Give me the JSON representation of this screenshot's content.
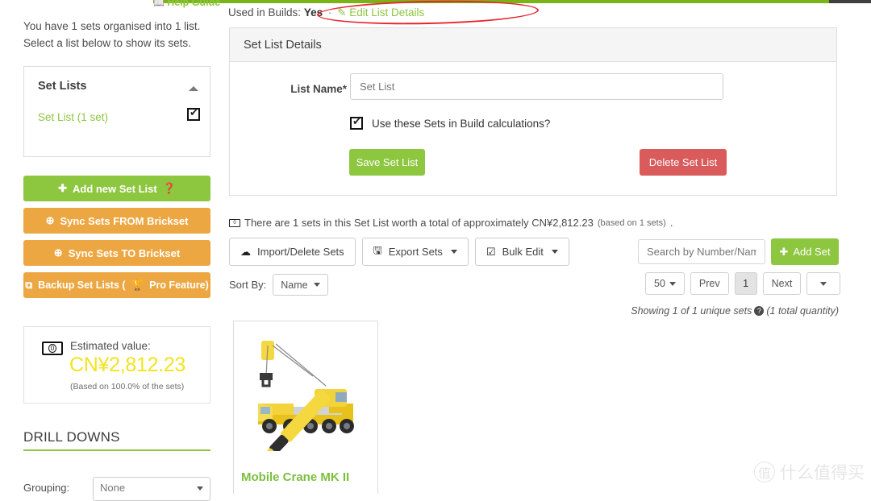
{
  "topbar": {
    "help_guide_label": "Help Guide",
    "accent_green": "#7ab317",
    "dark": "#3f3f3f"
  },
  "sidebar": {
    "intro_text": "You have 1 sets organised into 1 list. Select a list below to show its sets.",
    "panel": {
      "title": "Set Lists",
      "collapse_icon": "chevron-up-icon",
      "items": [
        {
          "label": "Set List (1 set)",
          "checked": true
        }
      ]
    },
    "buttons": [
      {
        "label": "Add new Set List",
        "icon": "plus-icon",
        "help_icon": "question-circle-icon",
        "color": "#8dc63f"
      },
      {
        "label": "Sync Sets FROM Brickset",
        "icon": "arrow-down-circle-icon",
        "color": "#eda742"
      },
      {
        "label": "Sync Sets TO Brickset",
        "icon": "arrow-up-circle-icon",
        "color": "#eda742"
      },
      {
        "label": "Backup Set Lists (",
        "label_suffix": "Pro Feature)",
        "icon": "copy-icon",
        "trophy_icon": "trophy-icon",
        "color": "#eda742"
      }
    ],
    "estimated_value": {
      "icon": "banknote-icon",
      "label": "Estimated value:",
      "amount": "CN¥2,812.23",
      "amount_color": "#f2e41f",
      "sub": "(Based on 100.0% of the sets)"
    },
    "drill_downs": {
      "title": "DRILL DOWNS",
      "grouping_label": "Grouping:",
      "grouping_value": "None"
    }
  },
  "main": {
    "builds_row": {
      "prefix": "Used in Builds:",
      "value": "Yes",
      "separator": "·",
      "edit_icon": "edit-square-icon",
      "edit_link": "Edit List Details",
      "annotation_color": "#e8242c"
    },
    "card": {
      "header": "Set List Details",
      "list_name_label": "List Name*",
      "list_name_value": "Set List",
      "list_name_placeholder": "Set List",
      "checkbox_label": "Use these Sets in Build calculations?",
      "checkbox_checked": true,
      "save_label": "Save Set List",
      "save_color": "#8dc63f",
      "delete_label": "Delete Set List",
      "delete_color": "#da5b5b"
    },
    "worth_line": {
      "icon": "banknote-icon",
      "text": "There are 1 sets in this Set List worth a total of approximately CN¥2,812.23",
      "small": "(based on 1 sets)",
      "tail": "."
    },
    "toolbar": [
      {
        "label": "Import/Delete Sets",
        "icon": "cloud-upload-icon",
        "caret": false
      },
      {
        "label": "Export Sets",
        "icon": "floppy-disk-icon",
        "caret": true
      },
      {
        "label": "Bulk Edit",
        "icon": "checkbox-icon",
        "caret": true
      }
    ],
    "sort": {
      "label": "Sort By:",
      "value": "Name"
    },
    "search": {
      "placeholder": "Search by Number/Nam",
      "value": ""
    },
    "add_set": {
      "label": "Add Set",
      "icon": "plus-icon",
      "color": "#8dc63f"
    },
    "pager": {
      "page_size": "50",
      "prev_label": "Prev",
      "current_page": "1",
      "next_label": "Next"
    },
    "showing": {
      "text": "Showing 1 of 1 unique sets",
      "help_icon": "question-circle-icon",
      "suffix": "(1 total quantity)"
    },
    "sets": [
      {
        "name": "Mobile Crane MK II",
        "image": "lego-mobile-crane-photo"
      }
    ]
  },
  "watermark": {
    "mark": "值",
    "text": "什么值得买"
  }
}
